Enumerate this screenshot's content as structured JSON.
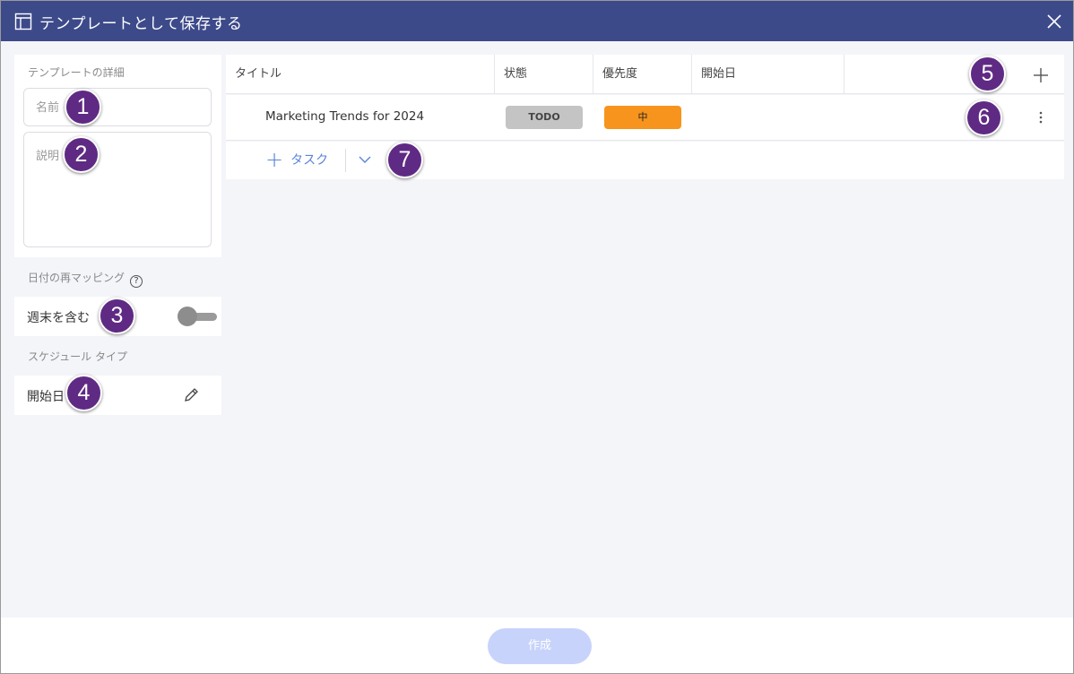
{
  "dialog": {
    "title": "テンプレートとして保存する",
    "create_label": "作成"
  },
  "left": {
    "details_label": "テンプレートの詳細",
    "name_placeholder": "名前",
    "description_placeholder": "説明",
    "date_remap_label": "日付の再マッピング",
    "help_glyph": "?",
    "include_weekends_label": "週末を含む",
    "include_weekends_on": false,
    "schedule_type_label": "スケジュール タイプ",
    "schedule_type_value": "開始日"
  },
  "table": {
    "columns": [
      "タイトル",
      "状態",
      "優先度",
      "開始日"
    ],
    "rows": [
      {
        "title": "Marketing Trends for 2024",
        "status": "TODO",
        "priority": "中",
        "start_date": ""
      }
    ],
    "add_task_label": "タスク"
  },
  "badges": [
    "1",
    "2",
    "3",
    "4",
    "5",
    "6",
    "7"
  ],
  "colors": {
    "titlebar": "#3d4a8a",
    "badge": "#5f2a84",
    "priority_medium": "#f7941d",
    "status_todo": "#c4c4c4",
    "link_blue": "#5b84d8",
    "create_disabled": "#c7d3fb"
  },
  "icons": [
    "template-icon",
    "close-icon",
    "help-icon",
    "pencil-icon",
    "plus-icon",
    "more-vertical-icon",
    "chevron-down-icon"
  ]
}
